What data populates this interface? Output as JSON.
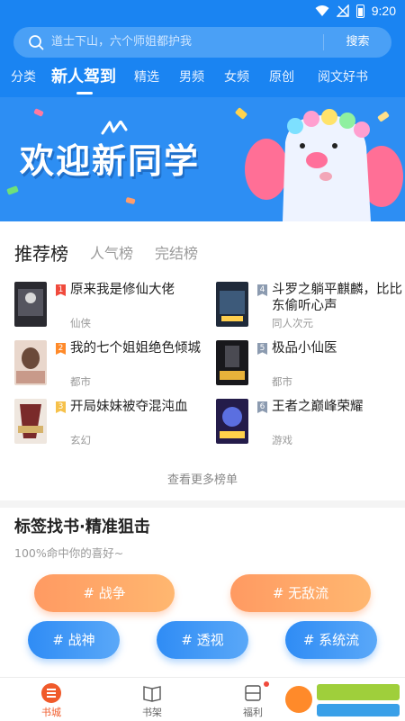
{
  "status": {
    "time": "9:20"
  },
  "search": {
    "placeholder": "道士下山，六个师姐都护我",
    "button": "搜索"
  },
  "tabs": [
    {
      "label": "分类"
    },
    {
      "label": "新人驾到",
      "active": true
    },
    {
      "label": "精选"
    },
    {
      "label": "男频"
    },
    {
      "label": "女频"
    },
    {
      "label": "原创"
    },
    {
      "label": "阅文好书"
    }
  ],
  "banner": {
    "text": "欢迎新同学"
  },
  "rank": {
    "tabs": [
      "推荐榜",
      "人气榜",
      "完结榜"
    ],
    "books": [
      {
        "rank": "1",
        "title": "原来我是修仙大佬",
        "genre": "仙侠"
      },
      {
        "rank": "2",
        "title": "我的七个姐姐绝色倾城",
        "genre": "都市"
      },
      {
        "rank": "3",
        "title": "开局妹妹被夺混沌血",
        "genre": "玄幻"
      },
      {
        "rank": "4",
        "title": "斗罗之躺平麒麟，比比东偷听心声",
        "genre": "同人次元"
      },
      {
        "rank": "5",
        "title": "极品小仙医",
        "genre": "都市"
      },
      {
        "rank": "6",
        "title": "王者之巅峰荣耀",
        "genre": "游戏"
      }
    ],
    "more": "查看更多榜单"
  },
  "tags": {
    "title": "标签找书·精准狙击",
    "subtitle": "100%命中你的喜好~",
    "items": [
      {
        "label": "# 战争",
        "color": "orange"
      },
      {
        "label": "# 无敌流",
        "color": "orange"
      },
      {
        "label": "# 战神",
        "color": "blue"
      },
      {
        "label": "# 透视",
        "color": "blue"
      },
      {
        "label": "# 系统流",
        "color": "blue"
      }
    ]
  },
  "bottom_nav": [
    {
      "label": "书城",
      "icon": "bookstore-icon",
      "active": true
    },
    {
      "label": "书架",
      "icon": "bookshelf-icon"
    },
    {
      "label": "福利",
      "icon": "welfare-icon"
    }
  ],
  "colors": {
    "accent": "#1a84f2",
    "orange": "#ff9a62",
    "active_nav": "#f05a2a"
  }
}
